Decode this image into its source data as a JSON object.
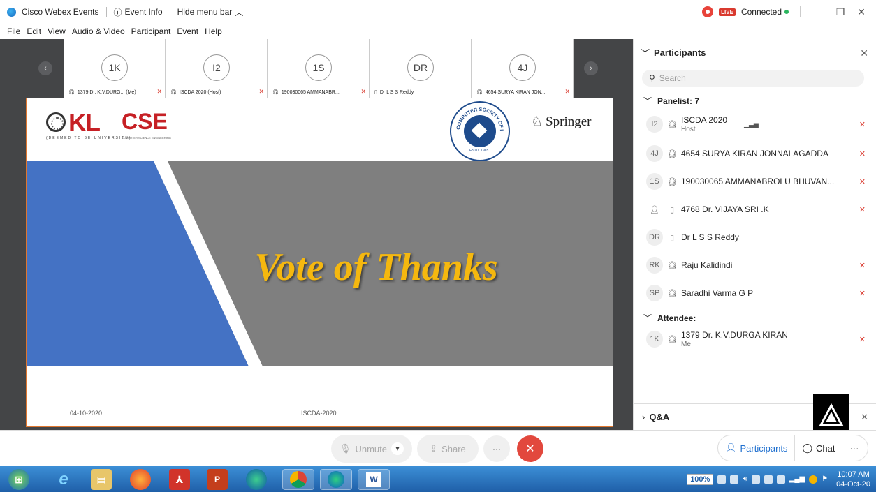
{
  "titlebar": {
    "app_name": "Cisco Webex Events",
    "event_info": "Event Info",
    "hide_menu": "Hide menu bar",
    "live_badge": "LIVE",
    "status": "Connected",
    "minimize": "–",
    "restore": "❐",
    "close": "✕"
  },
  "menu": [
    "File",
    "Edit",
    "View",
    "Audio & Video",
    "Participant",
    "Event",
    "Help"
  ],
  "thumbnails": [
    {
      "initials": "1K",
      "name": "1379 Dr. K.V.DURG... (Me)"
    },
    {
      "initials": "I2",
      "name": "ISCDA 2020 (Host)"
    },
    {
      "initials": "1S",
      "name": "190030065 AMMANABR..."
    },
    {
      "initials": "DR",
      "name": "Dr L S S Reddy"
    },
    {
      "initials": "4J",
      "name": "4654 SURYA KIRAN JON..."
    }
  ],
  "slide": {
    "kl_logo": "KL",
    "kl_sub": "(DEEMED TO BE UNIVERSITY)",
    "cse": "CSE",
    "cse_sub": "COMPUTER SCIENCE ENGINEERING",
    "csi_text": "COMPUTER SOCIETY OF INDIA",
    "csi_estd": "ESTD. 1965",
    "springer": "Springer",
    "title": "Vote of Thanks",
    "date": "04-10-2020",
    "conference": "ISCDA-2020"
  },
  "controls": {
    "unmute": "Unmute",
    "share": "Share",
    "more": "···",
    "participants": "Participants",
    "chat": "Chat",
    "more_right": "···"
  },
  "panel": {
    "title": "Participants",
    "search_placeholder": "Search",
    "panelist_label": "Panelist: 7",
    "attendee_label": "Attendee:",
    "qa_label": "Q&A",
    "panelists": [
      {
        "initials": "I2",
        "name": "ISCDA 2020",
        "sub": "Host",
        "muted": true
      },
      {
        "initials": "4J",
        "name": "4654 SURYA KIRAN JONNALAGADDA",
        "sub": "",
        "muted": true
      },
      {
        "initials": "1S",
        "name": "190030065 AMMANABROLU BHUVAN...",
        "sub": "",
        "muted": true
      },
      {
        "initials": "",
        "name": "4768 Dr. VIJAYA SRI .K",
        "sub": "",
        "muted": true
      },
      {
        "initials": "DR",
        "name": "Dr L S S Reddy",
        "sub": "",
        "muted": false
      },
      {
        "initials": "RK",
        "name": "Raju Kalidindi",
        "sub": "",
        "muted": true
      },
      {
        "initials": "SP",
        "name": "Saradhi Varma G P",
        "sub": "",
        "muted": true
      }
    ],
    "attendees": [
      {
        "initials": "1K",
        "name": "1379 Dr. K.V.DURGA KIRAN",
        "sub": "Me",
        "muted": true
      }
    ]
  },
  "taskbar": {
    "zoom": "100%",
    "time": "10:07 AM",
    "date": "04-Oct-20"
  },
  "colors": {
    "accent": "#e0772f",
    "live": "#d93a2f",
    "slide_title": "#f5b80f",
    "slide_blue": "#4472c4"
  }
}
